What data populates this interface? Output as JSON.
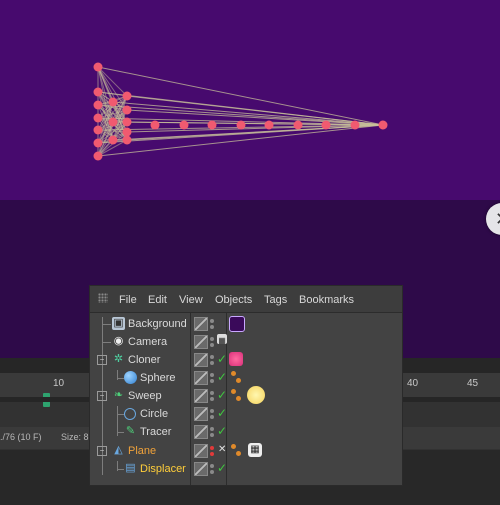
{
  "viewport": {
    "colors": {
      "floor": "#470a6e",
      "sky": "#2e0a49",
      "node": "#f05a70",
      "edge": "#c8c09a"
    }
  },
  "close_button": {
    "label": "✕"
  },
  "timeline": {
    "ruler_labels": [
      "10",
      "40",
      "45"
    ],
    "frame_info": "./76 (10 F)",
    "size_info": "Size: 8"
  },
  "object_manager": {
    "menu": [
      "File",
      "Edit",
      "View",
      "Objects",
      "Tags",
      "Bookmarks"
    ],
    "objects": [
      {
        "name": "Background",
        "icon": "background-icon",
        "depth": 0
      },
      {
        "name": "Camera",
        "icon": "camera-icon",
        "depth": 0
      },
      {
        "name": "Cloner",
        "icon": "cloner-icon",
        "depth": 0,
        "expanded": true
      },
      {
        "name": "Sphere",
        "icon": "sphere-icon",
        "depth": 1
      },
      {
        "name": "Sweep",
        "icon": "sweep-icon",
        "depth": 0,
        "expanded": true
      },
      {
        "name": "Circle",
        "icon": "circle-spline-icon",
        "depth": 1
      },
      {
        "name": "Tracer",
        "icon": "tracer-icon",
        "depth": 1
      },
      {
        "name": "Plane",
        "icon": "plane-icon",
        "depth": 0,
        "expanded": true
      },
      {
        "name": "Displacer",
        "icon": "displacer-icon",
        "depth": 1
      }
    ],
    "colors": {
      "plane": "#f0a23a",
      "displacer_selected": "#ffce3a",
      "check": "#40c840",
      "disabled": "#e23a3a"
    }
  }
}
